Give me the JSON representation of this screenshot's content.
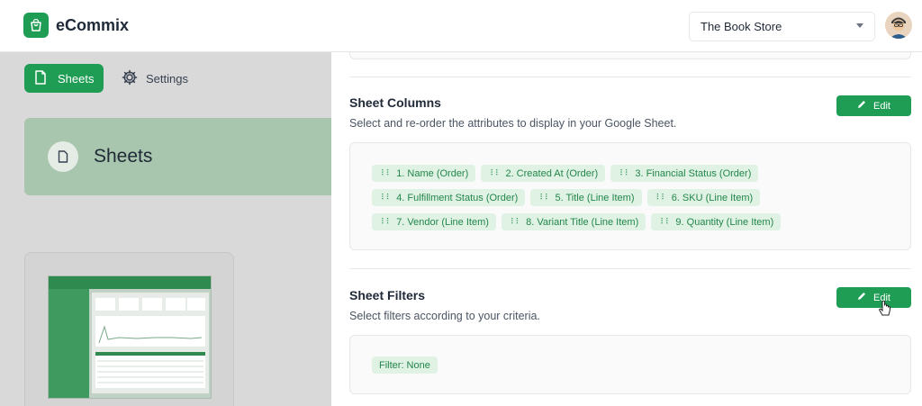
{
  "app": {
    "name": "eCommix"
  },
  "store_selector": {
    "value": "The Book Store"
  },
  "nav": {
    "sheets_label": "Sheets",
    "settings_label": "Settings"
  },
  "hero": {
    "title": "Sheets"
  },
  "columns": {
    "title": "Sheet Columns",
    "description": "Select and re-order the attributes to display in your Google Sheet.",
    "edit_label": "Edit",
    "items": [
      "1. Name (Order)",
      "2. Created At (Order)",
      "3. Financial Status (Order)",
      "4. Fulfillment Status (Order)",
      "5. Title (Line Item)",
      "6. SKU (Line Item)",
      "7. Vendor (Line Item)",
      "8. Variant Title (Line Item)",
      "9. Quantity (Line Item)"
    ]
  },
  "filters": {
    "title": "Sheet Filters",
    "description": "Select filters according to your criteria.",
    "edit_label": "Edit",
    "current": "Filter: None"
  },
  "colors": {
    "brand": "#1f9d55",
    "chip_bg": "#dff2e4",
    "chip_text": "#22864a"
  },
  "icons": {
    "logo": "shopping-bag-icon",
    "sheets": "document-icon",
    "settings": "gear-icon",
    "edit": "pencil-icon",
    "grip": "drag-handle-icon",
    "dropdown": "chevron-down-icon"
  }
}
